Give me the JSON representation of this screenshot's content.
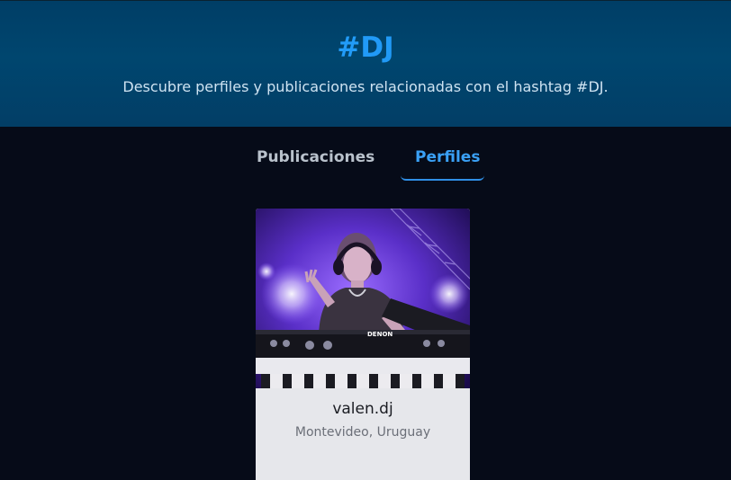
{
  "hero": {
    "title": "#DJ",
    "subtitle": "Descubre perfiles y publicaciones relacionadas con el hashtag #DJ."
  },
  "tabs": [
    {
      "label": "Publicaciones",
      "active": false
    },
    {
      "label": "Perfiles",
      "active": true
    }
  ],
  "profiles": [
    {
      "name": "valen.dj",
      "location": "Montevideo, Uruguay",
      "photo_text": "DENON"
    }
  ],
  "colors": {
    "accent": "#3aa0f5",
    "hero_bg": "#00466f",
    "page_bg": "#060b18",
    "card_bg": "#e6e7eb"
  }
}
